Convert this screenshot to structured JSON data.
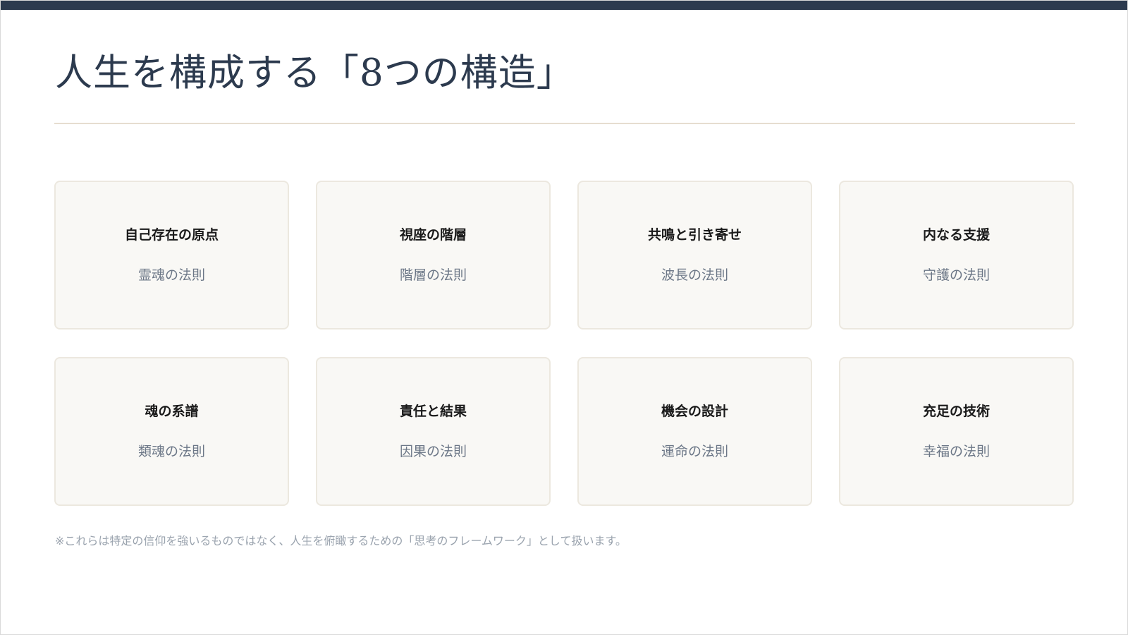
{
  "title": "人生を構成する「8つの構造」",
  "cards": [
    {
      "title": "自己存在の原点",
      "subtitle": "霊魂の法則"
    },
    {
      "title": "視座の階層",
      "subtitle": "階層の法則"
    },
    {
      "title": "共鳴と引き寄せ",
      "subtitle": "波長の法則"
    },
    {
      "title": "内なる支援",
      "subtitle": "守護の法則"
    },
    {
      "title": "魂の系譜",
      "subtitle": "類魂の法則"
    },
    {
      "title": "責任と結果",
      "subtitle": "因果の法則"
    },
    {
      "title": "機会の設計",
      "subtitle": "運命の法則"
    },
    {
      "title": "充足の技術",
      "subtitle": "幸福の法則"
    }
  ],
  "footnote": "※これらは特定の信仰を強いるものではなく、人生を俯瞰するための「思考のフレームワーク」として扱います。",
  "colors": {
    "accent_bar": "#2c3a4e",
    "title": "#2c3a4e",
    "card_background": "#f9f8f5",
    "card_border": "#ece8df",
    "divider": "#e6ddd0"
  }
}
